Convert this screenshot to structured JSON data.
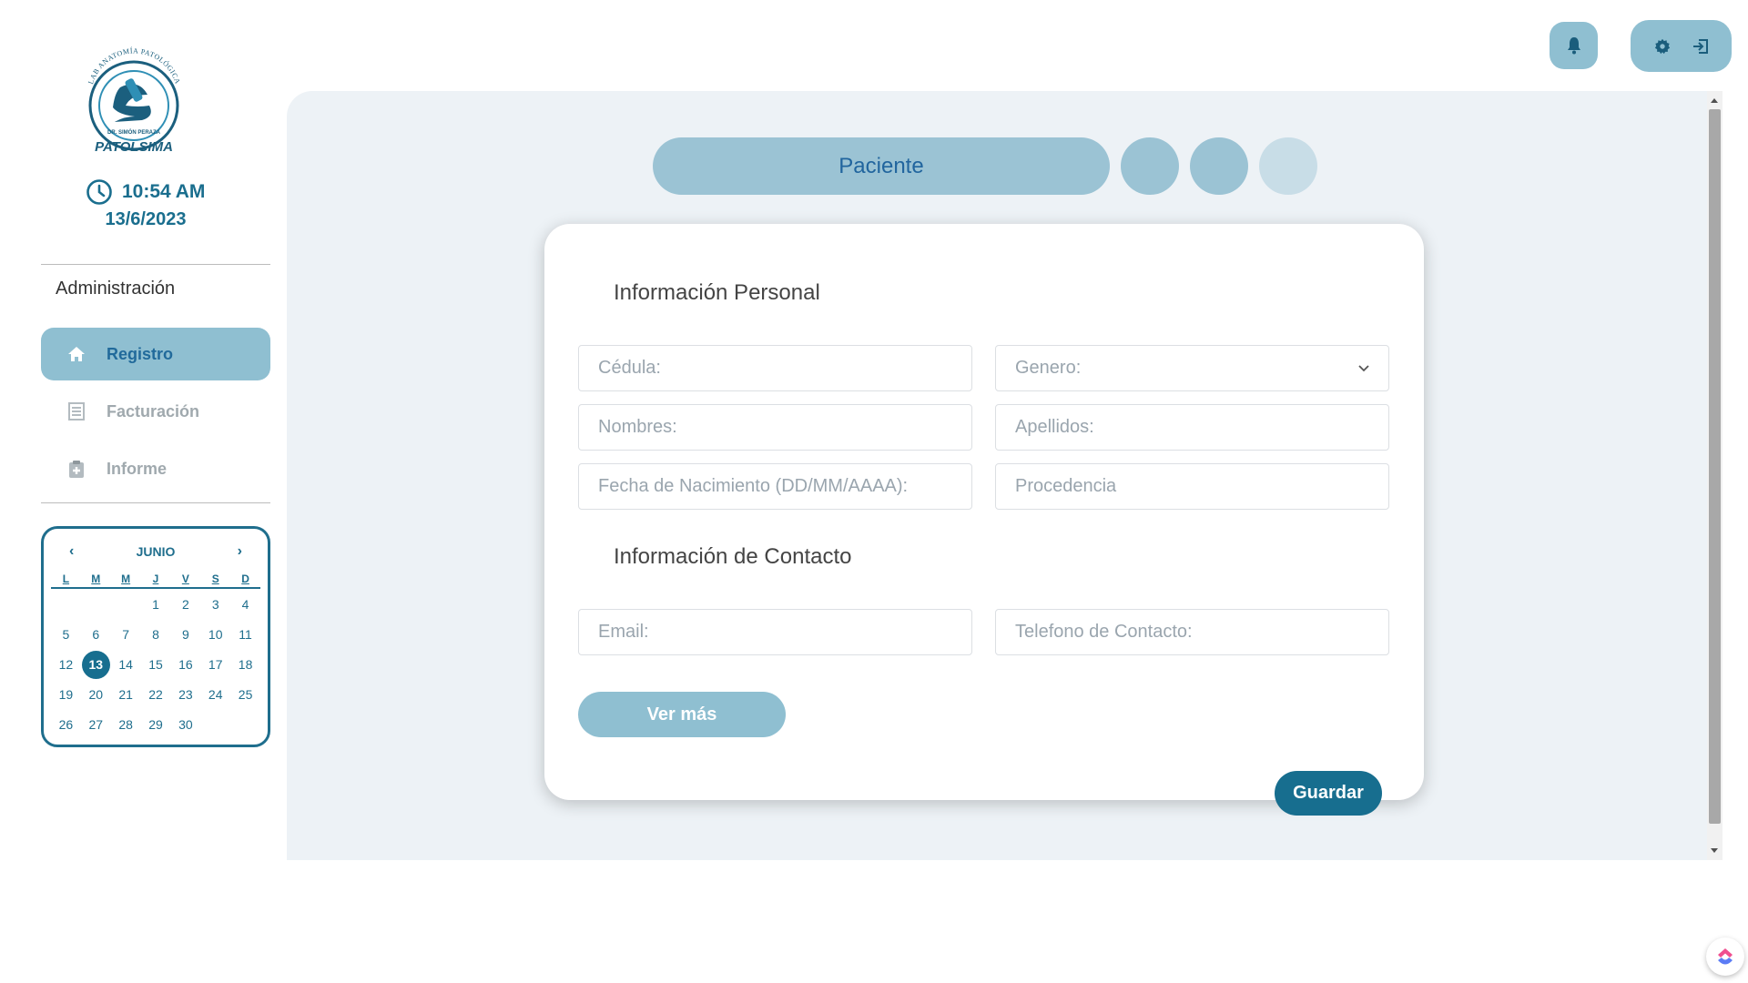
{
  "brand": {
    "logo_top_text": "LAB ANATOMÍA PATOLÓGICA",
    "logo_doctor": "DR. SIMÓN PERAZA",
    "logo_name": "PATOLSIMA"
  },
  "clock": {
    "time": "10:54 AM",
    "date": "13/6/2023"
  },
  "sidebar": {
    "section_label": "Administración",
    "items": [
      {
        "label": "Registro",
        "icon": "home-icon",
        "active": true
      },
      {
        "label": "Facturación",
        "icon": "invoice-icon",
        "active": false
      },
      {
        "label": "Informe",
        "icon": "clipboard-plus-icon",
        "active": false
      }
    ]
  },
  "calendar": {
    "prev": "‹",
    "next": "›",
    "month": "JUNIO",
    "weekdays": [
      "L",
      "M",
      "M",
      "J",
      "V",
      "S",
      "D"
    ],
    "leading_blanks": 3,
    "days": [
      "1",
      "2",
      "3",
      "4",
      "5",
      "6",
      "7",
      "8",
      "9",
      "10",
      "11",
      "12",
      "13",
      "14",
      "15",
      "16",
      "17",
      "18",
      "19",
      "20",
      "21",
      "22",
      "23",
      "24",
      "25",
      "26",
      "27",
      "28",
      "29",
      "30"
    ],
    "today": "13"
  },
  "header": {
    "bell_icon": "bell-icon",
    "settings_icon": "gear-icon",
    "logout_icon": "logout-icon"
  },
  "tabs": {
    "main_label": "Paciente"
  },
  "form": {
    "personal_title": "Información Personal",
    "cedula_placeholder": "Cédula:",
    "genero_placeholder": "Genero:",
    "nombres_placeholder": "Nombres:",
    "apellidos_placeholder": "Apellidos:",
    "nacimiento_placeholder": "Fecha de Nacimiento (DD/MM/AAAA):",
    "procedencia_placeholder": "Procedencia",
    "contact_title": "Información de Contacto",
    "email_placeholder": "Email:",
    "telefono_placeholder": "Telefono de Contacto:",
    "ver_mas_label": "Ver más",
    "guardar_label": "Guardar"
  },
  "colors": {
    "accent": "#176e8f",
    "accent_light": "#8fbfd1",
    "panel_bg": "#edf2f6"
  }
}
